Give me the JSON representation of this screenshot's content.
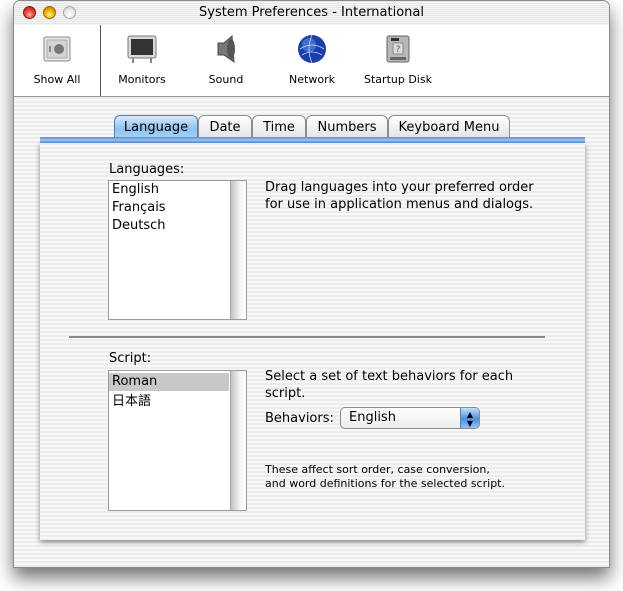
{
  "window": {
    "title": "System Preferences - International",
    "controls": {
      "close": "close-button",
      "minimize": "minimize-button",
      "zoom": "zoom-button"
    }
  },
  "toolbar": {
    "items": [
      {
        "label": "Show All",
        "icon": "show-all-icon"
      },
      {
        "label": "Monitors",
        "icon": "monitor-icon"
      },
      {
        "label": "Sound",
        "icon": "speaker-icon"
      },
      {
        "label": "Network",
        "icon": "globe-icon"
      },
      {
        "label": "Startup Disk",
        "icon": "hard-disk-icon"
      }
    ]
  },
  "tabs": [
    {
      "label": "Language",
      "active": true
    },
    {
      "label": "Date",
      "active": false
    },
    {
      "label": "Time",
      "active": false
    },
    {
      "label": "Numbers",
      "active": false
    },
    {
      "label": "Keyboard Menu",
      "active": false
    }
  ],
  "languages": {
    "label": "Languages:",
    "items": [
      "English",
      "Français",
      "Deutsch"
    ],
    "help": "Drag languages into your preferred order for use in application menus and dialogs."
  },
  "script": {
    "label": "Script:",
    "items": [
      "Roman",
      "日本語"
    ],
    "selected": "Roman",
    "help": "Select a set of text behaviors for each script.",
    "behaviors_label": "Behaviors:",
    "behaviors_value": "English",
    "note": "These affect sort order, case conversion, and word definitions for the selected script."
  },
  "colors": {
    "accent": "#4a90e2",
    "selection": "#c8c8c8",
    "close": "#e8453b",
    "minimize": "#f5b300"
  }
}
